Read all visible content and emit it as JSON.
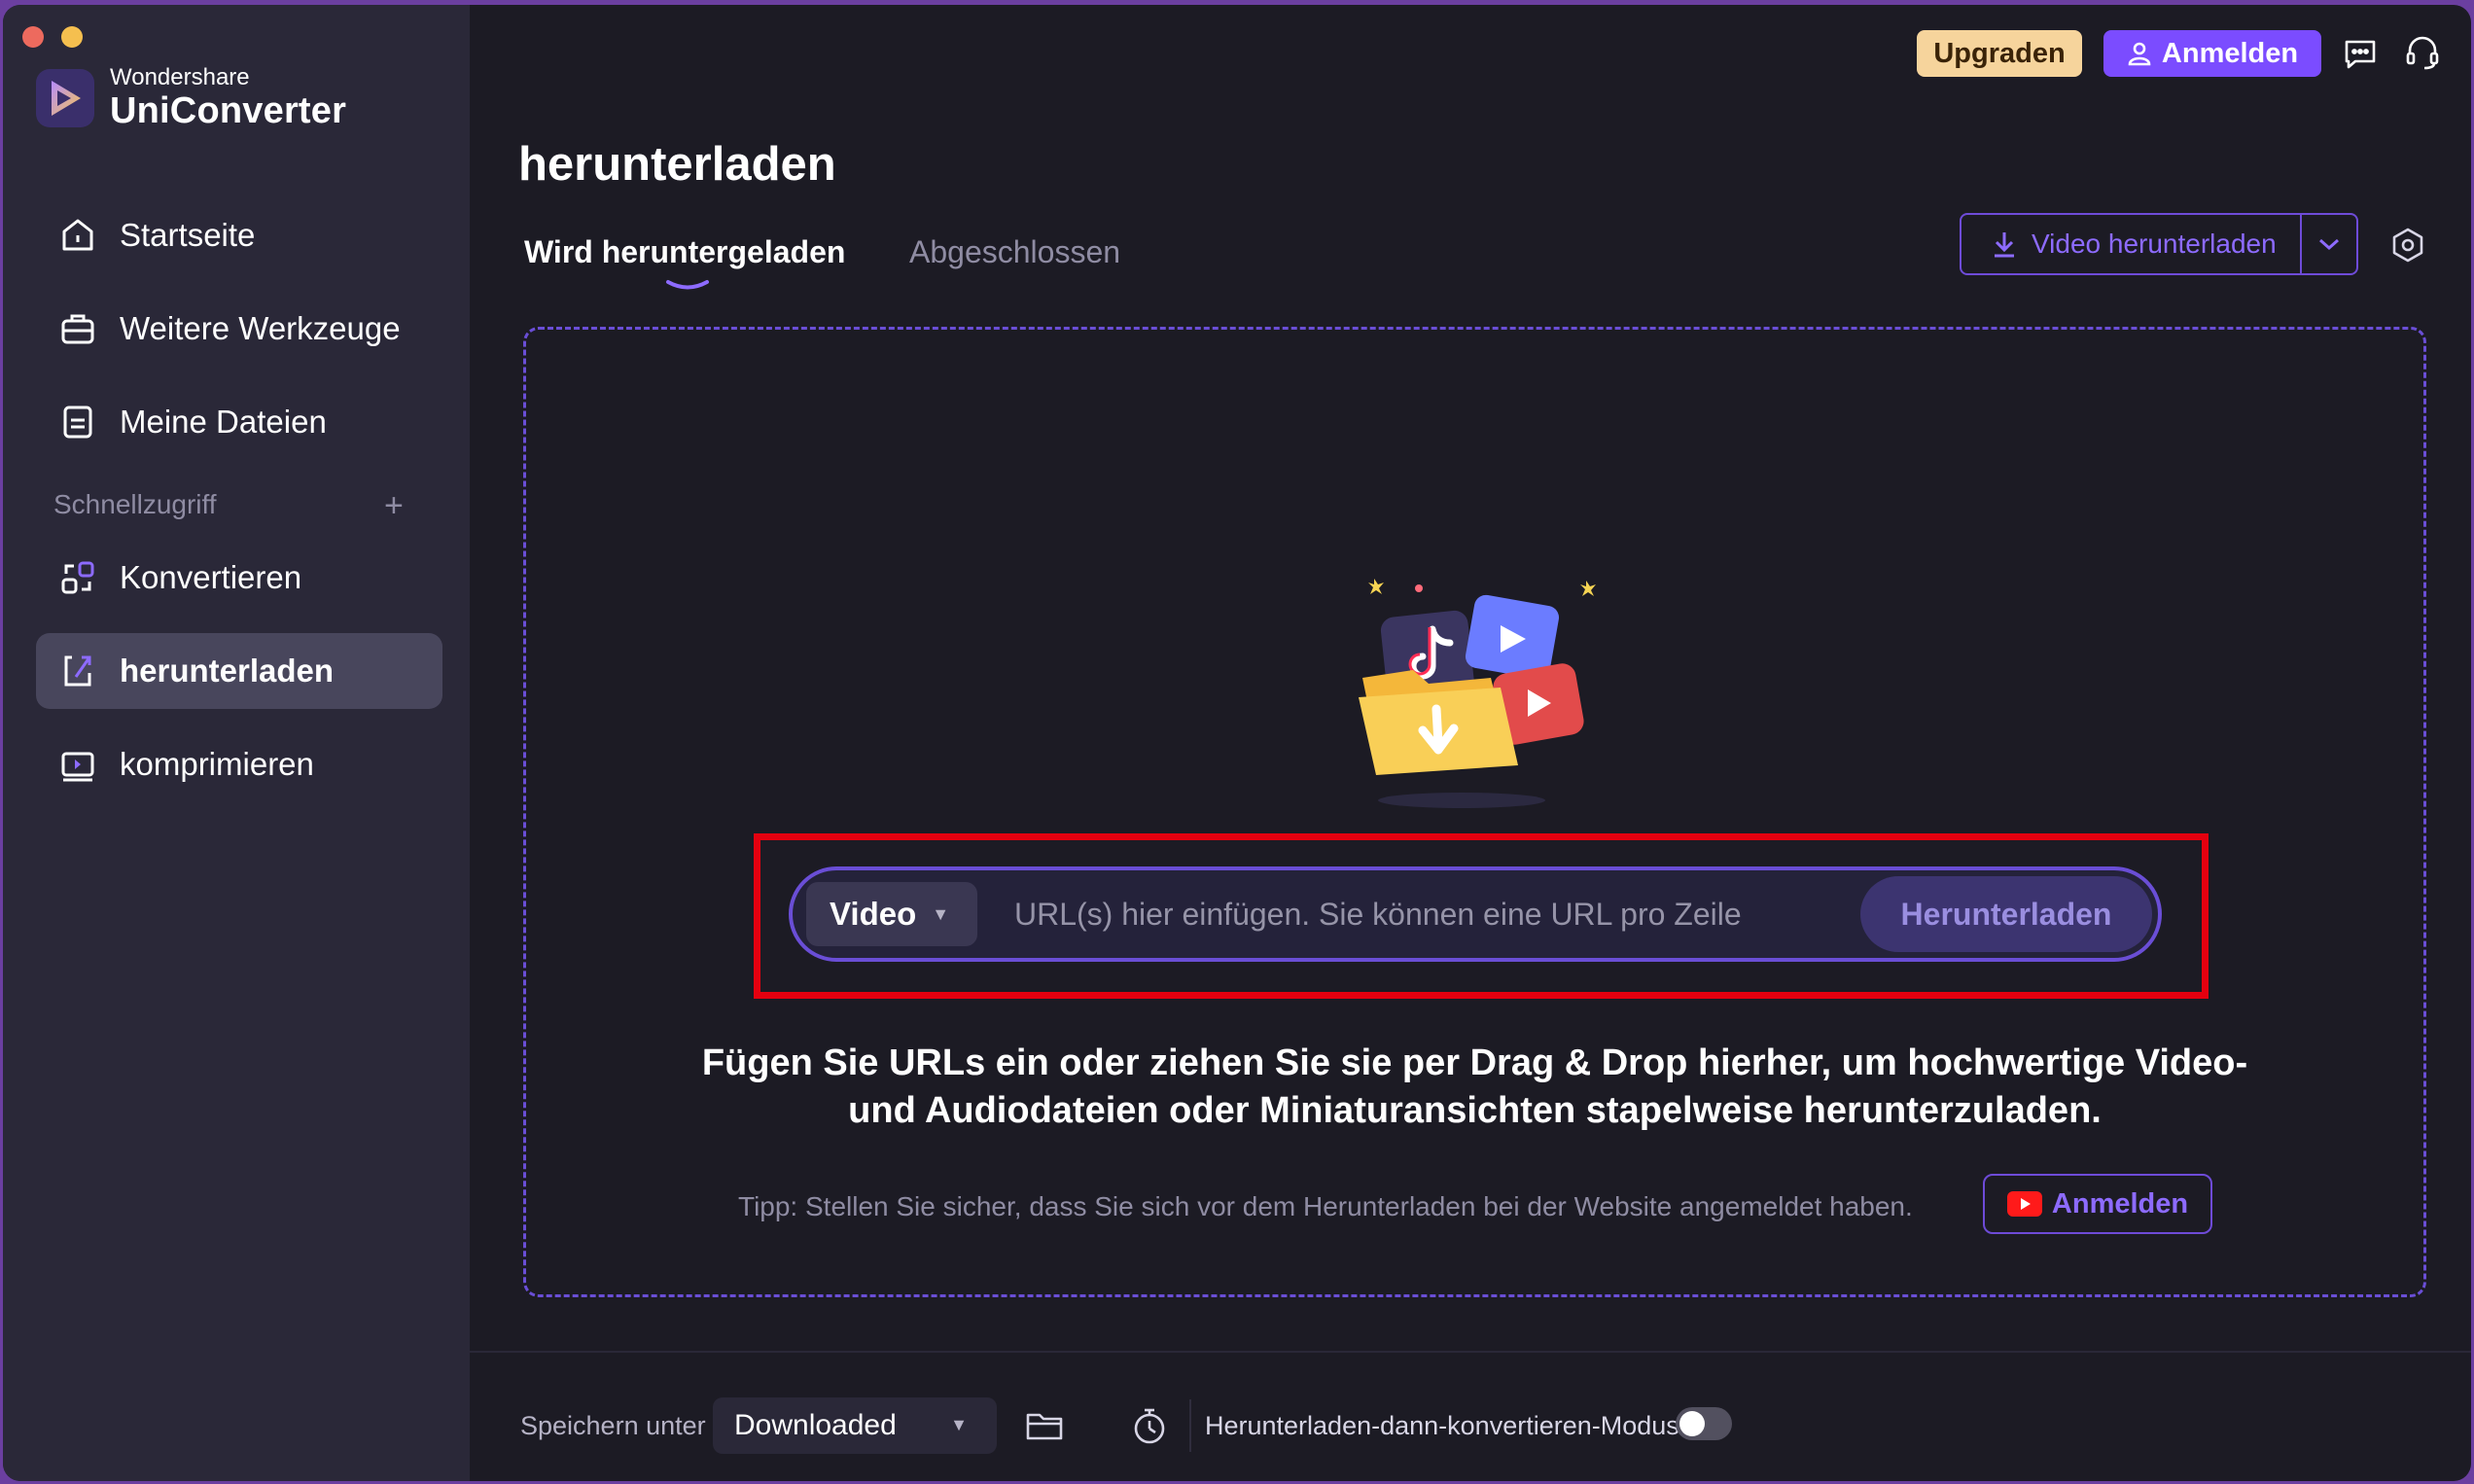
{
  "app": {
    "brand_sub": "Wondershare",
    "brand_name": "UniConverter"
  },
  "sidebar": {
    "items": [
      {
        "label": "Startseite",
        "icon": "home-icon"
      },
      {
        "label": "Weitere Werkzeuge",
        "icon": "toolbox-icon"
      },
      {
        "label": "Meine Dateien",
        "icon": "files-icon"
      }
    ],
    "quick_access_label": "Schnellzugriff",
    "quick_items": [
      {
        "label": "Konvertieren",
        "icon": "convert-icon"
      },
      {
        "label": "herunterladen",
        "icon": "download-icon",
        "active": true
      },
      {
        "label": "komprimieren",
        "icon": "compress-icon"
      }
    ]
  },
  "header": {
    "upgrade_label": "Upgraden",
    "login_label": "Anmelden"
  },
  "page": {
    "title": "herunterladen",
    "tabs": [
      {
        "label": "Wird heruntergeladen",
        "active": true
      },
      {
        "label": "Abgeschlossen",
        "active": false
      }
    ],
    "download_button_label": "Video herunterladen"
  },
  "url_bar": {
    "type_value": "Video",
    "placeholder": "URL(s) hier einfügen. Sie können eine URL pro Zeile",
    "button_label": "Herunterladen"
  },
  "description": {
    "line1": "Fügen Sie URLs ein oder ziehen Sie sie per Drag & Drop hierher, um hochwertige Video-",
    "line2": "und Audiodateien oder Miniaturansichten stapelweise herunterzuladen."
  },
  "tip": {
    "text": "Tipp: Stellen Sie sicher, dass Sie sich vor dem Herunterladen bei der Website angemeldet haben.",
    "login_label": "Anmelden"
  },
  "footer": {
    "save_label": "Speichern unter",
    "save_value": "Downloaded",
    "mode_label": "Herunterladen-dann-konvertieren-Modus",
    "mode_enabled": false
  },
  "colors": {
    "accent": "#7b4cff",
    "highlight": "#e4000f",
    "upgrade": "#f6d49c"
  }
}
